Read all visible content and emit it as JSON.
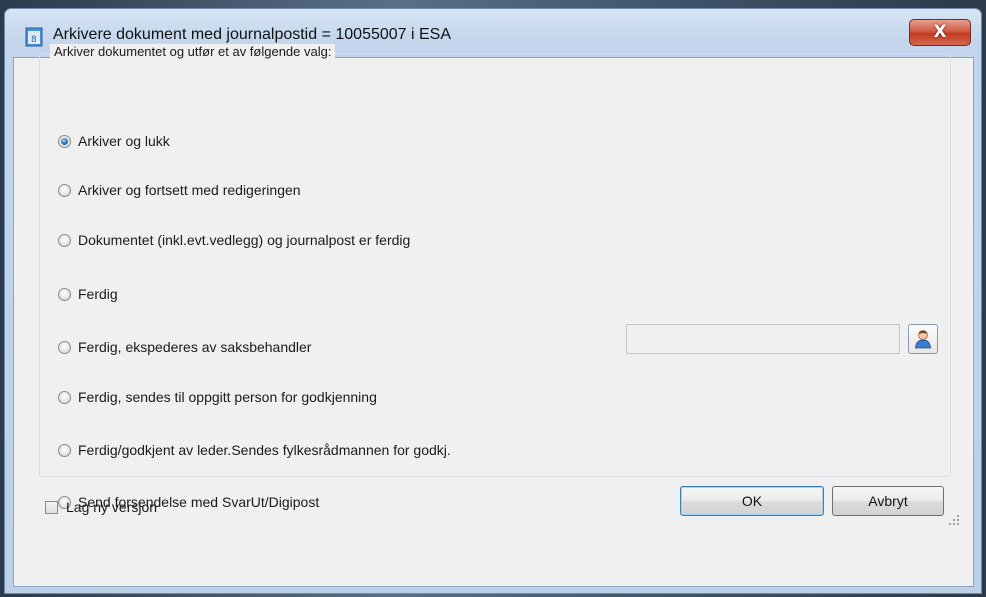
{
  "window": {
    "title": "Arkivere dokument med journalpostid = 10055007 i ESA",
    "close_label": "X"
  },
  "group": {
    "label": "Arkiver dokumentet og utfør et av følgende valg:",
    "options": [
      {
        "label": "Arkiver og lukk",
        "checked": true
      },
      {
        "label": "Arkiver og fortsett med redigeringen",
        "checked": false
      },
      {
        "label": "Dokumentet (inkl.evt.vedlegg) og journalpost er ferdig",
        "checked": false
      },
      {
        "label": "Ferdig",
        "checked": false
      },
      {
        "label": "Ferdig, ekspederes av saksbehandler",
        "checked": false
      },
      {
        "label": "Ferdig, sendes til oppgitt person for godkjenning",
        "checked": false
      },
      {
        "label": "Ferdig/godkjent av leder.Sendes fylkesrådmannen for godkj.",
        "checked": false
      },
      {
        "label": "Send forsendelse med SvarUt/Digipost",
        "checked": false
      }
    ],
    "person_field_value": ""
  },
  "footer": {
    "new_version_label": "Lag ny versjon",
    "new_version_checked": false,
    "ok_label": "OK",
    "cancel_label": "Avbryt"
  },
  "icons": {
    "app": "document-icon",
    "person_picker": "person-icon"
  }
}
